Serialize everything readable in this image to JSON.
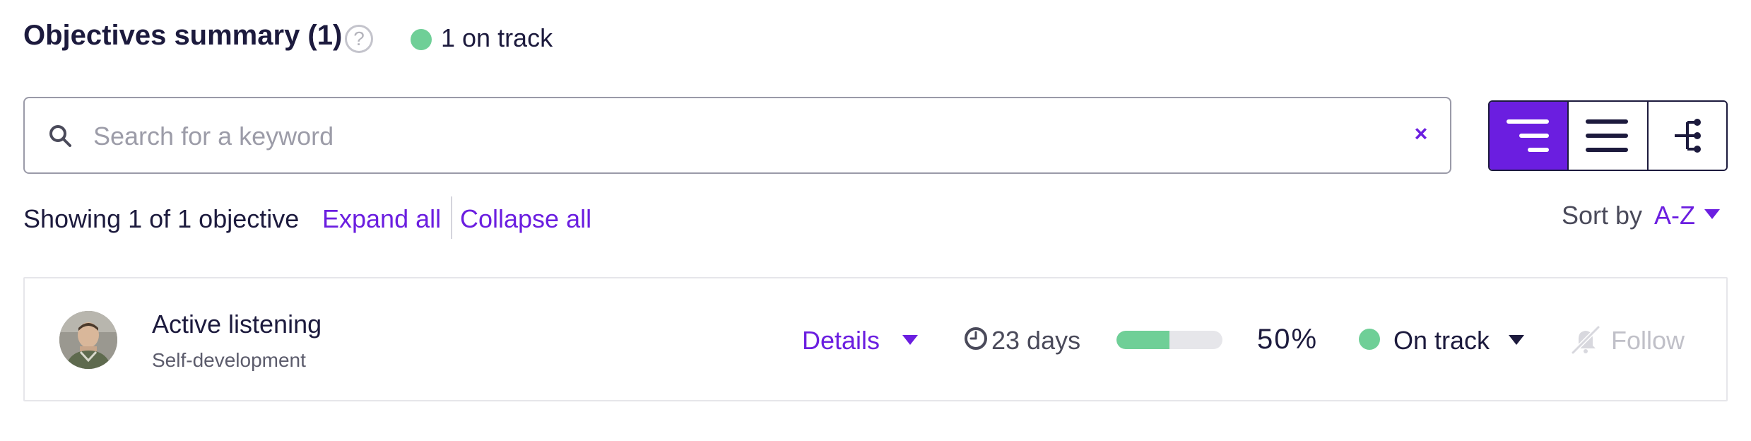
{
  "header": {
    "title": "Objectives summary (1)",
    "help_glyph": "?",
    "status_summary": "1 on track",
    "status_color": "#6fcf97"
  },
  "search": {
    "placeholder": "Search for a keyword",
    "value": "",
    "clear_glyph": "×"
  },
  "view_toggle": {
    "options": [
      "tree-view-icon",
      "list-view-icon",
      "hierarchy-view-icon"
    ],
    "active": "tree-view-icon"
  },
  "filters": {
    "showing_text": "Showing 1 of 1 objective",
    "expand_label": "Expand all",
    "collapse_label": "Collapse all",
    "sort_label": "Sort by",
    "sort_value": "A-Z"
  },
  "objectives": [
    {
      "title": "Active listening",
      "subtitle": "Self-development",
      "details_label": "Details",
      "days_left": "23 days",
      "progress_fraction": 0.5,
      "percent_text": "50%",
      "status_label": "On track",
      "status_color": "#6fcf97",
      "follow_label": "Follow"
    }
  ],
  "colors": {
    "accent": "#6b1ee0",
    "text": "#1c1a3d",
    "on_track": "#6fcf97"
  }
}
